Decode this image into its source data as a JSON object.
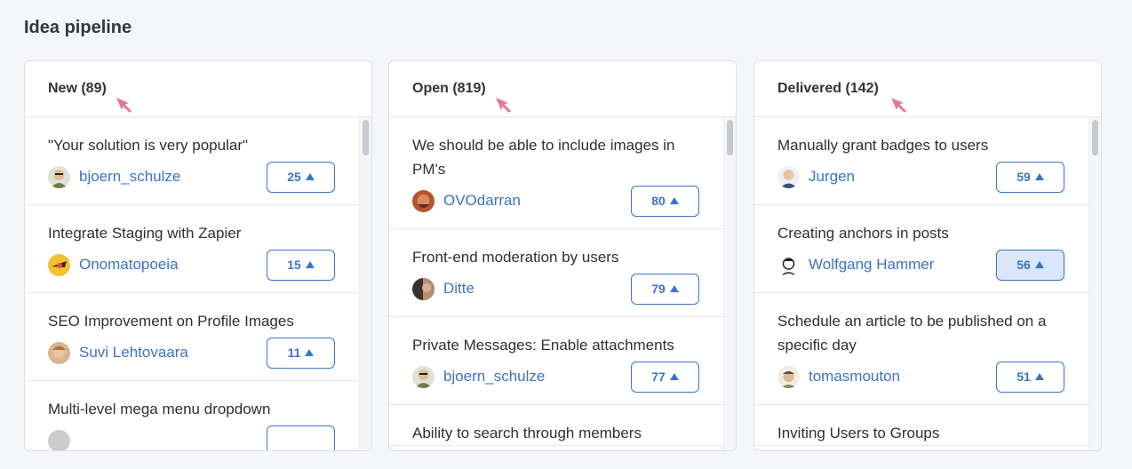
{
  "page": {
    "title": "Idea pipeline"
  },
  "columns": [
    {
      "title": "New (89)",
      "ideas": [
        {
          "title": "\"Your solution is very popular\"",
          "author": "bjoern_schulze",
          "votes": "25",
          "avatar_color": "#6f7b4e"
        },
        {
          "title": "Integrate Staging with Zapier",
          "author": "Onomatopoeia",
          "votes": "15",
          "avatar_color": "#f2c230"
        },
        {
          "title": "SEO Improvement on Profile Images",
          "author": "Suvi Lehtovaara",
          "votes": "11",
          "avatar_color": "#c9936a"
        },
        {
          "title": "Multi-level mega menu dropdown",
          "author": "",
          "votes": "",
          "avatar_color": "#cccccc"
        }
      ]
    },
    {
      "title": "Open (819)",
      "ideas": [
        {
          "title": "We should be able to include images in PM's",
          "author": "OVOdarran",
          "votes": "80",
          "avatar_color": "#b5542f"
        },
        {
          "title": "Front-end moderation by users",
          "author": "Ditte",
          "votes": "79",
          "avatar_color": "#3a3130"
        },
        {
          "title": "Private Messages: Enable attachments",
          "author": "bjoern_schulze",
          "votes": "77",
          "avatar_color": "#6f7b4e"
        },
        {
          "title": "Ability to search through members",
          "author": "",
          "votes": "",
          "avatar_color": "#cccccc"
        }
      ]
    },
    {
      "title": "Delivered (142)",
      "ideas": [
        {
          "title": "Manually grant badges to users",
          "author": "Jurgen",
          "votes": "59",
          "avatar_color": "#5a6d9c"
        },
        {
          "title": "Creating anchors in posts",
          "author": "Wolfgang Hammer",
          "votes": "56",
          "avatar_color": "#e9e9e9",
          "voted": true
        },
        {
          "title": "Schedule an article to be published on a specific day",
          "author": "tomasmouton",
          "votes": "51",
          "avatar_color": "#8a8f6a"
        },
        {
          "title": "Inviting Users to Groups",
          "author": "",
          "votes": "",
          "avatar_color": "#cccccc"
        }
      ]
    }
  ],
  "colors": {
    "accent": "#3a73c7",
    "cursor": "#e8749a",
    "voted_bg": "#d9e6fb"
  },
  "icons": {
    "vote": "up-triangle-icon",
    "cursor": "mouse-cursor-icon"
  }
}
